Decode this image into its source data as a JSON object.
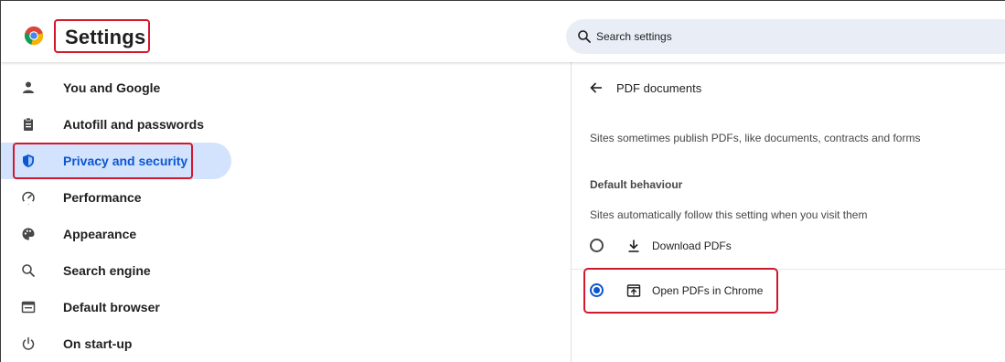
{
  "header": {
    "title": "Settings",
    "search_placeholder": "Search settings"
  },
  "sidebar": {
    "items": [
      {
        "label": "You and Google",
        "icon": "person-icon"
      },
      {
        "label": "Autofill and passwords",
        "icon": "clipboard-icon"
      },
      {
        "label": "Privacy and security",
        "icon": "shield-icon",
        "active": true
      },
      {
        "label": "Performance",
        "icon": "speedometer-icon"
      },
      {
        "label": "Appearance",
        "icon": "palette-icon"
      },
      {
        "label": "Search engine",
        "icon": "search-icon"
      },
      {
        "label": "Default browser",
        "icon": "browser-window-icon"
      },
      {
        "label": "On start-up",
        "icon": "power-icon"
      }
    ]
  },
  "panel": {
    "title": "PDF documents",
    "description": "Sites sometimes publish PDFs, like documents, contracts and forms",
    "section_heading": "Default behaviour",
    "section_description": "Sites automatically follow this setting when you visit them",
    "options": [
      {
        "label": "Download PDFs",
        "icon": "download-icon",
        "selected": false
      },
      {
        "label": "Open PDFs in Chrome",
        "icon": "open-in-browser-icon",
        "selected": true
      }
    ]
  },
  "colors": {
    "accent": "#0b57d0",
    "active_bg": "#d3e3fd",
    "highlight_box": "#d3182d",
    "search_bg": "#e9eef6"
  }
}
